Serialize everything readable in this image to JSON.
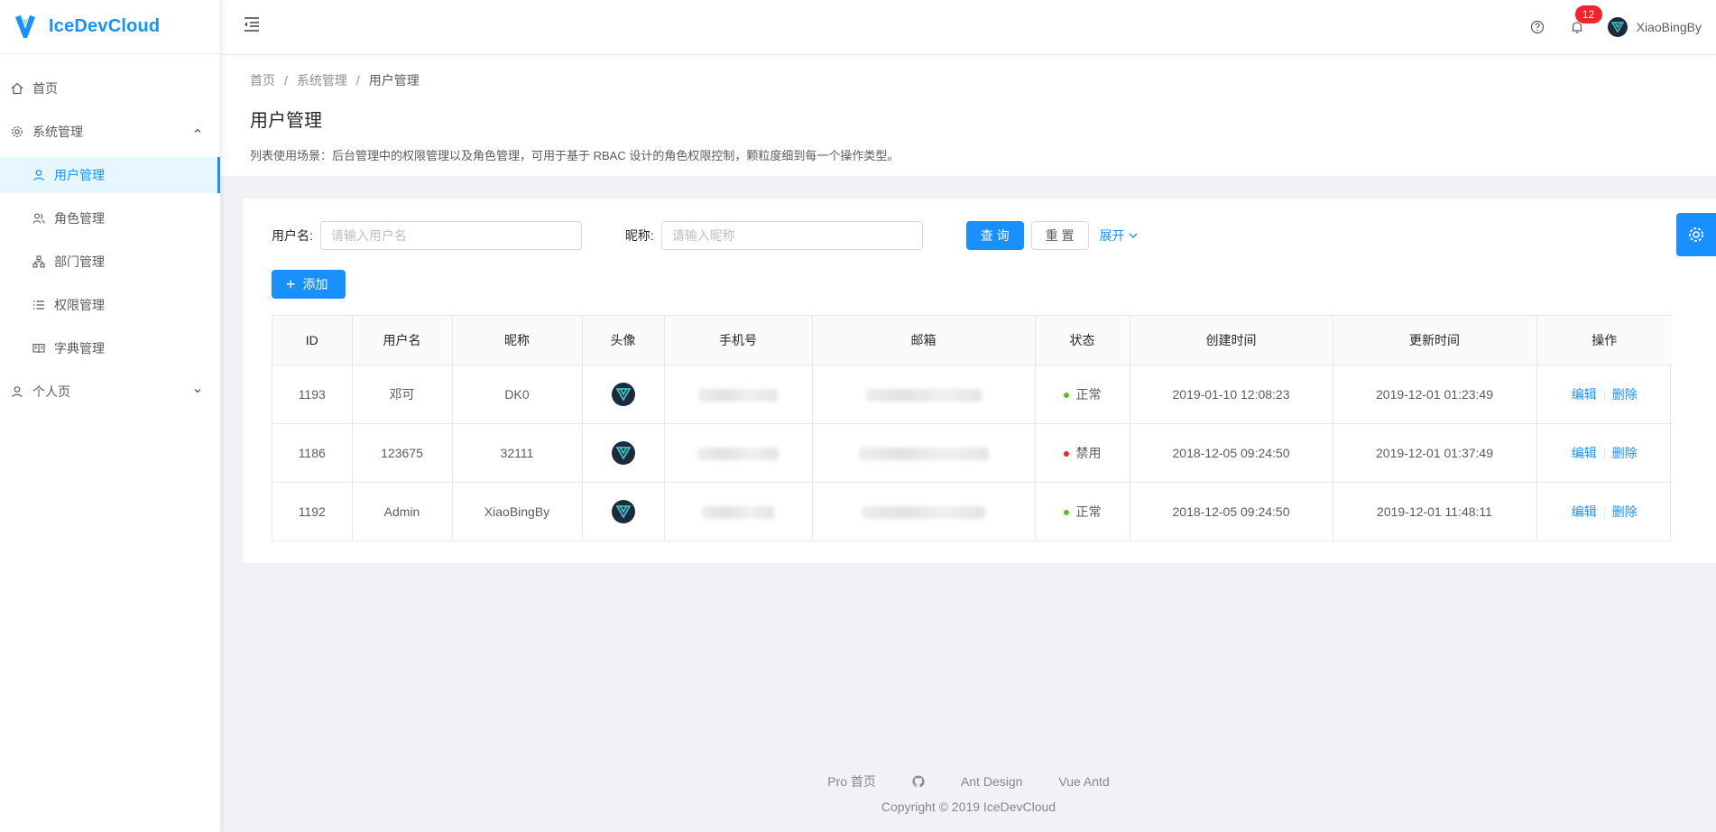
{
  "app": {
    "name": "IceDevCloud",
    "brand_color": "#1890ff"
  },
  "sidebar": {
    "items": [
      {
        "label": "首页",
        "icon": "home-icon"
      },
      {
        "label": "系统管理",
        "icon": "setting-icon",
        "expanded": true
      },
      {
        "label": "用户管理",
        "icon": "user-icon",
        "selected": true
      },
      {
        "label": "角色管理",
        "icon": "team-icon"
      },
      {
        "label": "部门管理",
        "icon": "apartment-icon"
      },
      {
        "label": "权限管理",
        "icon": "list-icon"
      },
      {
        "label": "字典管理",
        "icon": "book-icon"
      },
      {
        "label": "个人页",
        "icon": "user-icon",
        "expanded": false
      }
    ]
  },
  "header": {
    "notification_count": "12",
    "username": "XiaoBingBy"
  },
  "page": {
    "breadcrumb": [
      "首页",
      "系统管理",
      "用户管理"
    ],
    "title": "用户管理",
    "description": "列表使用场景：后台管理中的权限管理以及角色管理，可用于基于 RBAC 设计的角色权限控制，颗粒度细到每一个操作类型。"
  },
  "search": {
    "username_label": "用户名:",
    "username_placeholder": "请输入用户名",
    "nickname_label": "昵称:",
    "nickname_placeholder": "请输入昵称",
    "query_label": "查 询",
    "reset_label": "重 置",
    "expand_label": "展开"
  },
  "toolbar": {
    "add_label": "添加"
  },
  "table": {
    "columns": [
      "ID",
      "用户名",
      "昵称",
      "头像",
      "手机号",
      "邮箱",
      "状态",
      "创建时间",
      "更新时间",
      "操作"
    ],
    "rows": [
      {
        "id": "1193",
        "username": "邓可",
        "nickname": "DK0",
        "status": "正常",
        "status_color": "#52c41a",
        "created": "2019-01-10 12:08:23",
        "updated": "2019-12-01 01:23:49"
      },
      {
        "id": "1186",
        "username": "123675",
        "nickname": "32111",
        "status": "禁用",
        "status_color": "#f5222d",
        "created": "2018-12-05 09:24:50",
        "updated": "2019-12-01 01:37:49"
      },
      {
        "id": "1192",
        "username": "Admin",
        "nickname": "XiaoBingBy",
        "status": "正常",
        "status_color": "#52c41a",
        "created": "2018-12-05 09:24:50",
        "updated": "2019-12-01 11:48:11"
      }
    ],
    "edit_label": "编辑",
    "delete_label": "删除"
  },
  "footer": {
    "links": [
      "Pro 首页",
      "Ant Design",
      "Vue Antd"
    ],
    "copyright": "Copyright © 2019 IceDevCloud"
  }
}
